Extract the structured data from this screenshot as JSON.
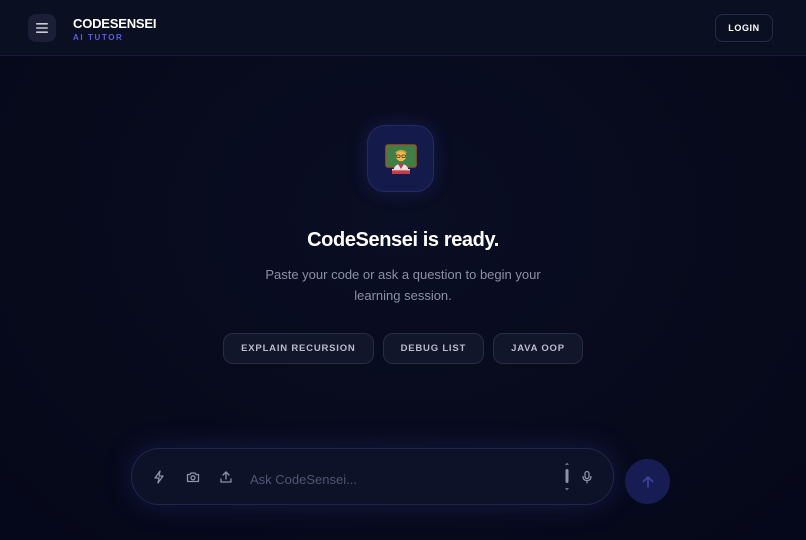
{
  "header": {
    "brand_name": "CODESENSEI",
    "brand_tagline": "AI TUTOR",
    "login_label": "LOGIN",
    "menu_icon": "hamburger-menu-icon"
  },
  "hero": {
    "avatar_icon": "teacher-emoji-icon",
    "title": "CodeSensei is ready.",
    "subtitle": "Paste your code or ask a question to begin your learning session."
  },
  "suggestions": [
    {
      "label": "EXPLAIN RECURSION"
    },
    {
      "label": "DEBUG LIST"
    },
    {
      "label": "JAVA OOP"
    }
  ],
  "composer": {
    "placeholder": "Ask CodeSensei...",
    "icons": [
      "lightning-icon",
      "camera-icon",
      "upload-icon",
      "scroll-handle-icon",
      "microphone-icon"
    ],
    "send_icon": "arrow-up-icon"
  },
  "colors": {
    "background": "#060919",
    "accent": "#5b5ce0",
    "send_button": "#171c52",
    "chip_background": "#12162a"
  }
}
